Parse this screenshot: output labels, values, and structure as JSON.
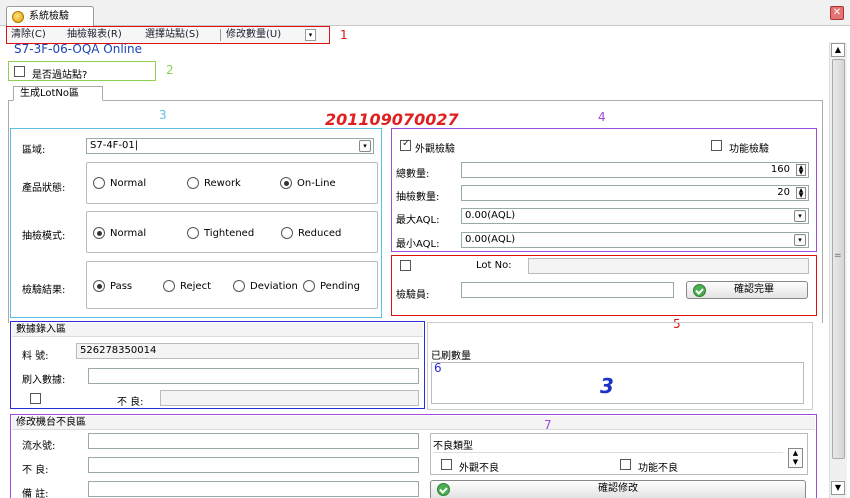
{
  "window": {
    "tab_title": "系統檢驗",
    "close": "✕"
  },
  "menu": {
    "clear": "清除(C)",
    "report": "抽檢報表(R)",
    "select_station": "選擇站點(S)",
    "modify_qty": "修改數量(U)",
    "dropdown": "▾"
  },
  "station_name": "S7-3F-06-OQA Online",
  "passed_station": {
    "label": "是否過站點?"
  },
  "tab": {
    "label": "生成LotNo區"
  },
  "lot_number": "201109070027",
  "annotations": {
    "n1": "1",
    "n2": "2",
    "n3": "3",
    "n4": "4",
    "n5": "5",
    "n6": "6",
    "n7": "7"
  },
  "left_panel": {
    "area_label": "區域:",
    "area_value": "S7-4F-01|",
    "status_label": "產品狀態:",
    "status_options": [
      "Normal",
      "Rework",
      "On-Line"
    ],
    "mode_label": "抽檢模式:",
    "mode_options": [
      "Normal",
      "Tightened",
      "Reduced"
    ],
    "result_label": "檢驗結果:",
    "result_options": [
      "Pass",
      "Reject",
      "Deviation",
      "Pending"
    ]
  },
  "right_panel": {
    "visual_check": "外觀檢驗",
    "function_check": "功能檢驗",
    "total_qty_label": "總數量:",
    "total_qty": "160",
    "sample_qty_label": "抽檢數量:",
    "sample_qty": "20",
    "max_aql_label": "最大AQL:",
    "max_aql": "0.00(AQL)",
    "min_aql_label": "最小AQL:",
    "min_aql": "0.00(AQL)"
  },
  "lot_panel": {
    "lot_no_label": "Lot No:",
    "inspector_label": "檢驗員:",
    "confirm_button": "確認完畢"
  },
  "data_entry": {
    "title": "數據錄入區",
    "part_no_label": "料 號:",
    "part_no": "526278350014",
    "scan_label": "刷入數據:",
    "defect_label": "不 良:"
  },
  "scanned": {
    "title": "已刷數量",
    "count": "3"
  },
  "modify": {
    "title": "修改機台不良區",
    "serial_label": "流水號:",
    "defect_label": "不 良:",
    "remark_label": "備 註:",
    "defect_type_title": "不良類型",
    "visual_defect": "外觀不良",
    "function_defect": "功能不良",
    "confirm_button": "確認修改"
  },
  "scroll": {
    "up": "▲",
    "down": "▼",
    "grip": "="
  }
}
